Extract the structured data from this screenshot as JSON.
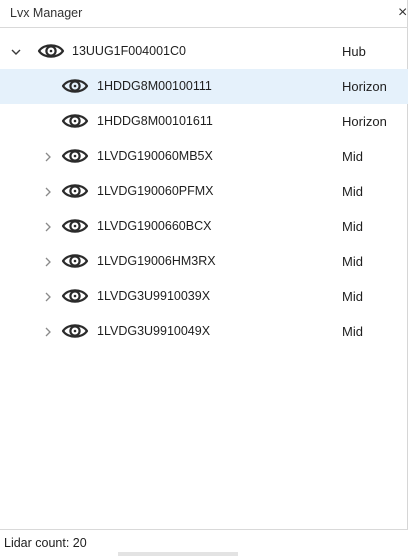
{
  "window": {
    "title": "Lvx Manager",
    "close_glyph": "×"
  },
  "tree": {
    "rows": [
      {
        "name": "13UUG1F004001C0",
        "type": "Hub",
        "level": 0,
        "expander": "expanded",
        "selected": false
      },
      {
        "name": "1HDDG8M00100111",
        "type": "Horizon",
        "level": 1,
        "expander": "none",
        "selected": true
      },
      {
        "name": "1HDDG8M00101611",
        "type": "Horizon",
        "level": 1,
        "expander": "none",
        "selected": false
      },
      {
        "name": "1LVDG190060MB5X",
        "type": "Mid",
        "level": 1,
        "expander": "collapsed",
        "selected": false
      },
      {
        "name": "1LVDG190060PFMX",
        "type": "Mid",
        "level": 1,
        "expander": "collapsed",
        "selected": false
      },
      {
        "name": "1LVDG1900660BCX",
        "type": "Mid",
        "level": 1,
        "expander": "collapsed",
        "selected": false
      },
      {
        "name": "1LVDG19006HM3RX",
        "type": "Mid",
        "level": 1,
        "expander": "collapsed",
        "selected": false
      },
      {
        "name": "1LVDG3U9910039X",
        "type": "Mid",
        "level": 1,
        "expander": "collapsed",
        "selected": false
      },
      {
        "name": "1LVDG3U9910049X",
        "type": "Mid",
        "level": 1,
        "expander": "collapsed",
        "selected": false
      }
    ]
  },
  "status": {
    "text": "Lidar count: 20"
  },
  "icons": {
    "visibility": "eye-icon",
    "expanded": "chevron-down-icon",
    "collapsed": "chevron-right-icon",
    "close": "close-icon"
  },
  "colors": {
    "selected_row": "#e5f1fb",
    "icon_stroke": "#2b2b2b",
    "chevron": "#8a8a8a"
  }
}
